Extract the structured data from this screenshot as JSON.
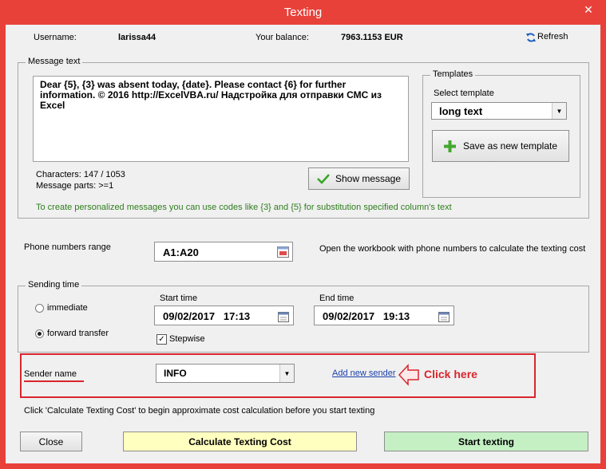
{
  "window": {
    "title": "Texting",
    "close_glyph": "✕"
  },
  "header": {
    "username_label": "Username:",
    "username_value": "larissa44",
    "balance_label": "Your balance:",
    "balance_value": "7963.1153 EUR",
    "refresh_label": "Refresh"
  },
  "message": {
    "group_title": "Message text",
    "text": "Dear {5}, {3} was absent today, {date}. Please contact {6} for further information. © 2016 http://ExcelVBA.ru/ Надстройка для отправки СМС из Excel",
    "characters_text": "Characters: 147 / 1053",
    "parts_text": "Message parts: >=1",
    "show_button_label": "Show message",
    "hint_text": "To create personalized messages you can use codes like {3} and {5} for substitution specified column's text"
  },
  "templates": {
    "group_title": "Templates",
    "select_label": "Select template",
    "selected": "long text",
    "save_button_label": "Save as new template"
  },
  "phones": {
    "label": "Phone numbers range",
    "range_value": "A1:A20",
    "note": "Open the workbook with phone numbers to calculate the texting cost"
  },
  "sending": {
    "group_title": "Sending time",
    "immediate_label": "immediate",
    "forward_label": "forward transfer",
    "start_label": "Start time",
    "start_value": "09/02/2017   17:13",
    "end_label": "End time",
    "end_value": "09/02/2017   19:13",
    "stepwise_label": "Stepwise",
    "stepwise_checked": "✓"
  },
  "sender": {
    "label": "Sender name",
    "selected": "INFO",
    "add_link": "Add new sender",
    "annotation": "Click here"
  },
  "footer": {
    "hint": "Click 'Calculate Texting Cost' to begin approximate cost calculation before you start texting",
    "close_label": "Close",
    "calc_label": "Calculate Texting Cost",
    "start_label": "Start texting"
  },
  "colors": {
    "frame": "#e8413a",
    "calc_button": "#ffffc0",
    "start_button": "#c4f0c4",
    "annotation": "#d8262d",
    "hint_green": "#2f7d1e"
  }
}
